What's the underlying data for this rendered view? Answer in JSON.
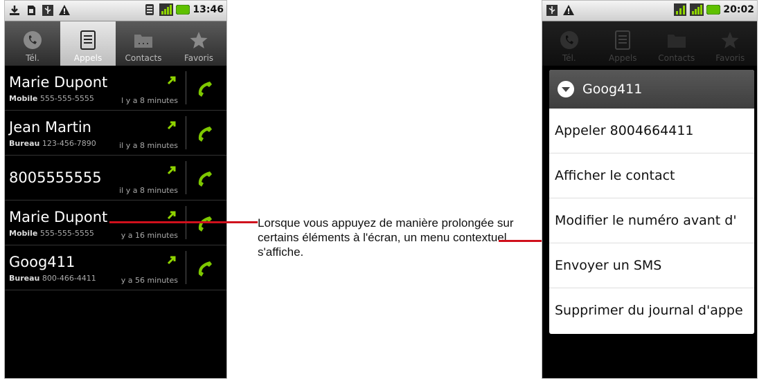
{
  "left_phone": {
    "status": {
      "time": "13:46",
      "icons": [
        "download-icon",
        "sdcard-icon",
        "usb-icon",
        "warning-icon",
        "wifi-icon",
        "signal-icon",
        "battery-icon"
      ]
    },
    "tabs": [
      {
        "label": "Tél.",
        "icon": "phone-icon",
        "active": false
      },
      {
        "label": "Appels",
        "icon": "call-log-icon",
        "active": true
      },
      {
        "label": "Contacts",
        "icon": "contacts-icon",
        "active": false
      },
      {
        "label": "Favoris",
        "icon": "star-icon",
        "active": false
      }
    ],
    "calls": [
      {
        "name": "Marie Dupont",
        "type": "Mobile",
        "number": "555-555-5555",
        "time": "l y a 8 minutes"
      },
      {
        "name": "Jean Martin",
        "type": "Bureau",
        "number": "123-456-7890",
        "time": "il y a 8 minutes"
      },
      {
        "name": "8005555555",
        "type": "",
        "number": "",
        "time": "il y a 8 minutes"
      },
      {
        "name": "Marie Dupont",
        "type": "Mobile",
        "number": "555-555-5555",
        "time": "y a 16 minutes"
      },
      {
        "name": "Goog411",
        "type": "Bureau",
        "number": "800-466-4411",
        "time": "y a 56 minutes"
      }
    ]
  },
  "right_phone": {
    "status": {
      "time": "20:02",
      "icons": [
        "usb-icon",
        "warning-icon",
        "3g-icon",
        "signal-icon",
        "battery-icon"
      ]
    },
    "tabs": [
      {
        "label": "Tél.",
        "icon": "phone-icon"
      },
      {
        "label": "Appels",
        "icon": "call-log-icon"
      },
      {
        "label": "Contacts",
        "icon": "contacts-icon"
      },
      {
        "label": "Favoris",
        "icon": "star-icon"
      }
    ],
    "menu": {
      "title": "Goog411",
      "items": [
        "Appeler 8004664411",
        "Afficher le contact",
        "Modifier le numéro avant d'",
        "Envoyer un SMS",
        "Supprimer du journal d'appe"
      ]
    }
  },
  "callout": {
    "text": "Lorsque vous appuyez de manière prolongée sur certains éléments à l'écran, un menu contextuel s'affiche."
  },
  "colors": {
    "accent_line": "#d0101c",
    "call_green": "#7ec800"
  }
}
